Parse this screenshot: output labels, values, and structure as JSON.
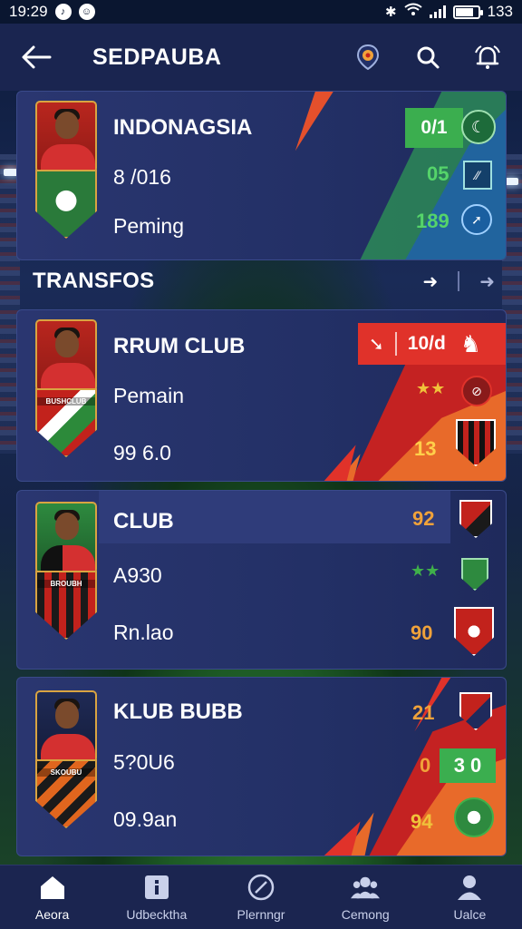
{
  "status_bar": {
    "time": "19:29",
    "battery": "133",
    "battery_level": 0.8,
    "notif_icons": [
      "tiktok-icon",
      "app-icon"
    ]
  },
  "header": {
    "title": "SEDPAUBA"
  },
  "featured": {
    "name": "INDONAGSIA",
    "line2": "8 /016",
    "line3": "Peming",
    "stats": [
      {
        "value": "0/1",
        "color": "#ffffff"
      },
      {
        "value": "05",
        "color": "#55d46a"
      },
      {
        "value": "189",
        "color": "#55d46a"
      }
    ]
  },
  "section": {
    "title": "TRANSFOS"
  },
  "cards": [
    {
      "name": "RRUM CLUB",
      "line2": "Pemain",
      "line3": "99 6.0",
      "tag": "10/d",
      "stat1": "",
      "stat2": "13",
      "crest_label": "BUSHCLUB"
    },
    {
      "name": "CLUB",
      "line2": "A930",
      "line3": "Rn.lao",
      "stat1": "92",
      "stat2": "90",
      "crest_label": "BROUBH"
    },
    {
      "name": "KLUB BUBB",
      "line2": "5?0U6",
      "line3": "09.9an",
      "stat1": "21",
      "stat_mid": "0",
      "stat_box": "3 0",
      "stat2": "94",
      "crest_label": "SKOUBU"
    }
  ],
  "tabs": [
    {
      "label": "Aeora",
      "icon": "home-icon",
      "active": true
    },
    {
      "label": "Udbecktha",
      "icon": "info-icon",
      "active": false
    },
    {
      "label": "Plernngr",
      "icon": "close-circle-icon",
      "active": false
    },
    {
      "label": "Cemong",
      "icon": "group-icon",
      "active": false
    },
    {
      "label": "Ualce",
      "icon": "profile-icon",
      "active": false
    }
  ],
  "colors": {
    "accent_red": "#e0322a",
    "accent_green": "#3fb04a",
    "gold": "#d9a441",
    "orange_stat": "#f0a23a"
  }
}
